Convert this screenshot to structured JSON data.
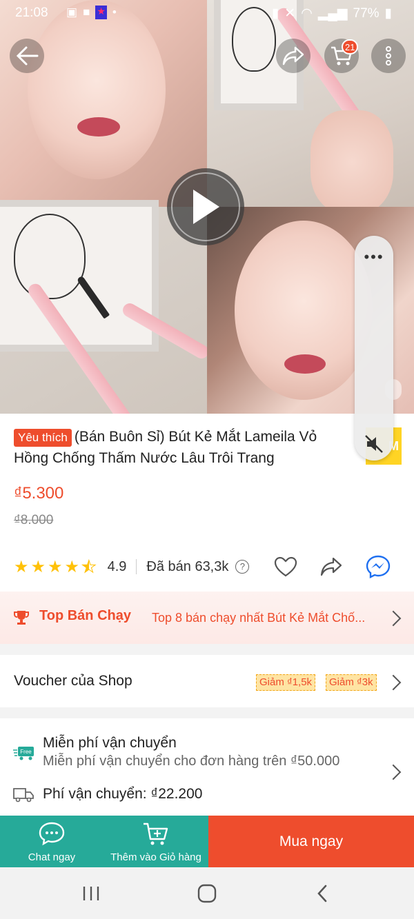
{
  "status_bar": {
    "time": "21:08",
    "battery": "77%"
  },
  "header": {
    "cart_count": "21"
  },
  "product": {
    "badge": "Yêu thích",
    "title": "(Bán Buôn Sỉ) Bút Kẻ Mắt Lameila Vỏ Hồng Chống Thấm Nước Lâu Trôi Trang",
    "price": "₫5.300",
    "original_price": "₫8.000",
    "rating": "4.9",
    "rating_stars": 4.5,
    "sold": "Đã bán 63,3k",
    "help_glyph": "?"
  },
  "top_selling": {
    "label": "Top Bán Chạy",
    "description": "Top 8 bán chạy nhất Bút Kẻ Mắt Chố..."
  },
  "voucher": {
    "label": "Voucher của Shop",
    "chips": [
      "Giảm ₫1,5k",
      "Giảm ₫3k"
    ]
  },
  "shipping": {
    "free_badge": "Free",
    "free_title": "Miễn phí vận chuyển",
    "free_desc": "Miễn phí vận chuyển cho đơn hàng trên ₫50.000",
    "fee": "Phí vận chuyển: ₫22.200"
  },
  "bottom_bar": {
    "chat_label": "Chat ngay",
    "add_cart_label": "Thêm vào Giỏ hàng",
    "buy_label": "Mua ngay"
  },
  "colors": {
    "brand": "#ee4d2d",
    "teal": "#26aa99",
    "star": "#ffc107"
  }
}
